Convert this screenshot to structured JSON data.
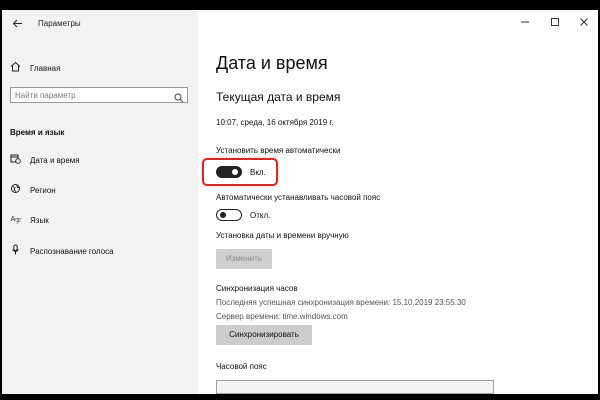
{
  "window": {
    "title": "Параметры",
    "back_icon": "arrow-left-icon",
    "controls": [
      "minimize-icon",
      "maximize-icon",
      "close-icon"
    ]
  },
  "sidebar": {
    "home_label": "Главная",
    "search_placeholder": "Найти параметр",
    "section": "Время и язык",
    "items": [
      {
        "label": "Дата и время",
        "icon": "calendar-clock-icon"
      },
      {
        "label": "Регион",
        "icon": "globe-icon"
      },
      {
        "label": "Язык",
        "icon": "language-icon"
      },
      {
        "label": "Распознавание голоса",
        "icon": "microphone-icon"
      }
    ]
  },
  "main": {
    "title": "Дата и время",
    "subtitle": "Текущая дата и время",
    "current_datetime": "10:07, среда, 16 октября 2019 г.",
    "auto_time": {
      "label": "Установить время автоматически",
      "state": "Вкл.",
      "on": true
    },
    "auto_timezone": {
      "label": "Автоматически устанавливать часовой пояс",
      "state": "Откл.",
      "on": false
    },
    "manual": {
      "label": "Установка даты и времени вручную",
      "button": "Изменить"
    },
    "sync": {
      "label": "Синхронизация часов",
      "last_sync": "Последняя успешная синхронизация времени: 15.10.2019 23:55:30",
      "server": "Сервер времени: time.windows.com",
      "button": "Синхронизировать"
    },
    "timezone_label": "Часовой пояс"
  },
  "colors": {
    "highlight": "#d12a2a",
    "sidebar_bg": "#f2f2f2"
  }
}
